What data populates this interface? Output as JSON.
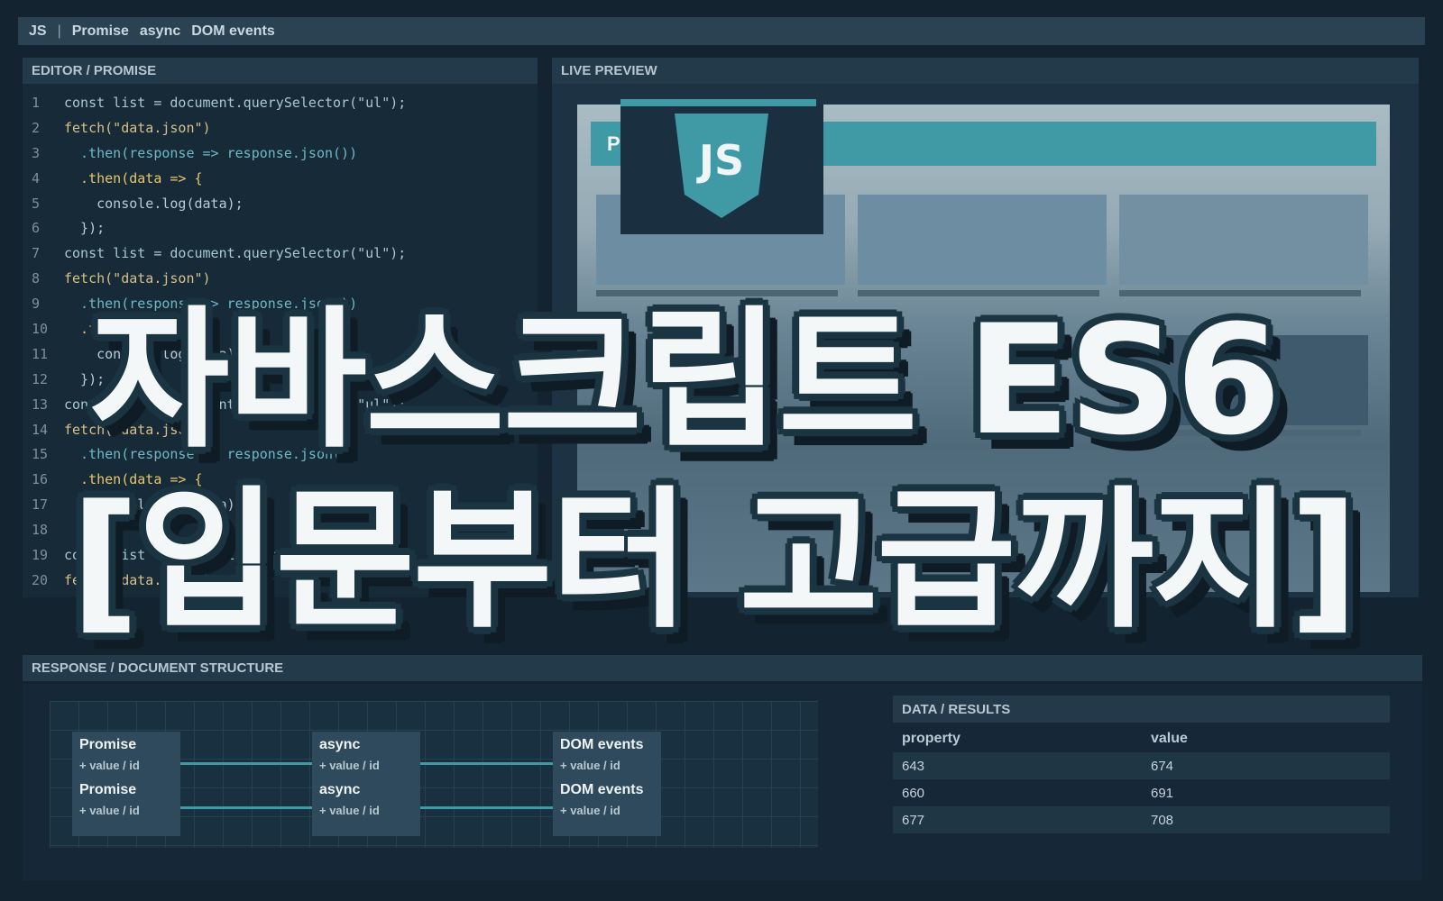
{
  "topbar": {
    "app": "JS",
    "separator": "|",
    "tabs": [
      "Promise",
      "async",
      "DOM events"
    ]
  },
  "editor": {
    "header": "EDITOR / PROMISE",
    "line_numbers": [
      "1",
      "2",
      "3",
      "4",
      "5",
      "6",
      "7",
      "8",
      "9",
      "10",
      "11",
      "12",
      "13",
      "14",
      "15",
      "16",
      "17",
      "18",
      "19",
      "20"
    ],
    "lines": [
      "const list = document.querySelector(\"ul\");",
      "fetch(\"data.json\")",
      "  .then(response => response.json())",
      "  .then(data => {",
      "    console.log(data);",
      "  });",
      "const list = document.querySelector(\"ul\");",
      "fetch(\"data.json\")",
      "  .then(response => response.json())",
      "  .then(data => {",
      "    console.log(data);",
      "  });",
      "const list = document.querySelector(\"ul\");",
      "fetch(\"data.json\")",
      "  .then(response => response.json())",
      "  .then(data => {",
      "    console.log(data);",
      "  });",
      "const list = document.querySelector(\"ul\");",
      "fetch(\"data.json\")"
    ]
  },
  "preview": {
    "header": "LIVE PREVIEW",
    "bar_text": "P",
    "badge": "JS"
  },
  "bottom": {
    "header": "RESPONSE / DOCUMENT STRUCTURE",
    "nodes": [
      {
        "title": "Promise",
        "sub": "+ value / id"
      },
      {
        "title": "Promise",
        "sub": "+ value / id"
      },
      {
        "title": "async",
        "sub": "+ value / id"
      },
      {
        "title": "async",
        "sub": "+ value / id"
      },
      {
        "title": "DOM events",
        "sub": "+ value / id"
      },
      {
        "title": "DOM events",
        "sub": "+ value / id"
      }
    ]
  },
  "results": {
    "header": "DATA / RESULTS",
    "columns": [
      "property",
      "value"
    ],
    "rows": [
      [
        "643",
        "674"
      ],
      [
        "660",
        "691"
      ],
      [
        "677",
        "708"
      ]
    ]
  },
  "title": {
    "line1": "자바스크립트 ES6",
    "line2": "[입문부터 고급까지]"
  },
  "colors": {
    "accent": "#3f9aa6",
    "background": "#142330",
    "title_fill": "#f4f7f8",
    "title_outline": "#1b3442"
  }
}
